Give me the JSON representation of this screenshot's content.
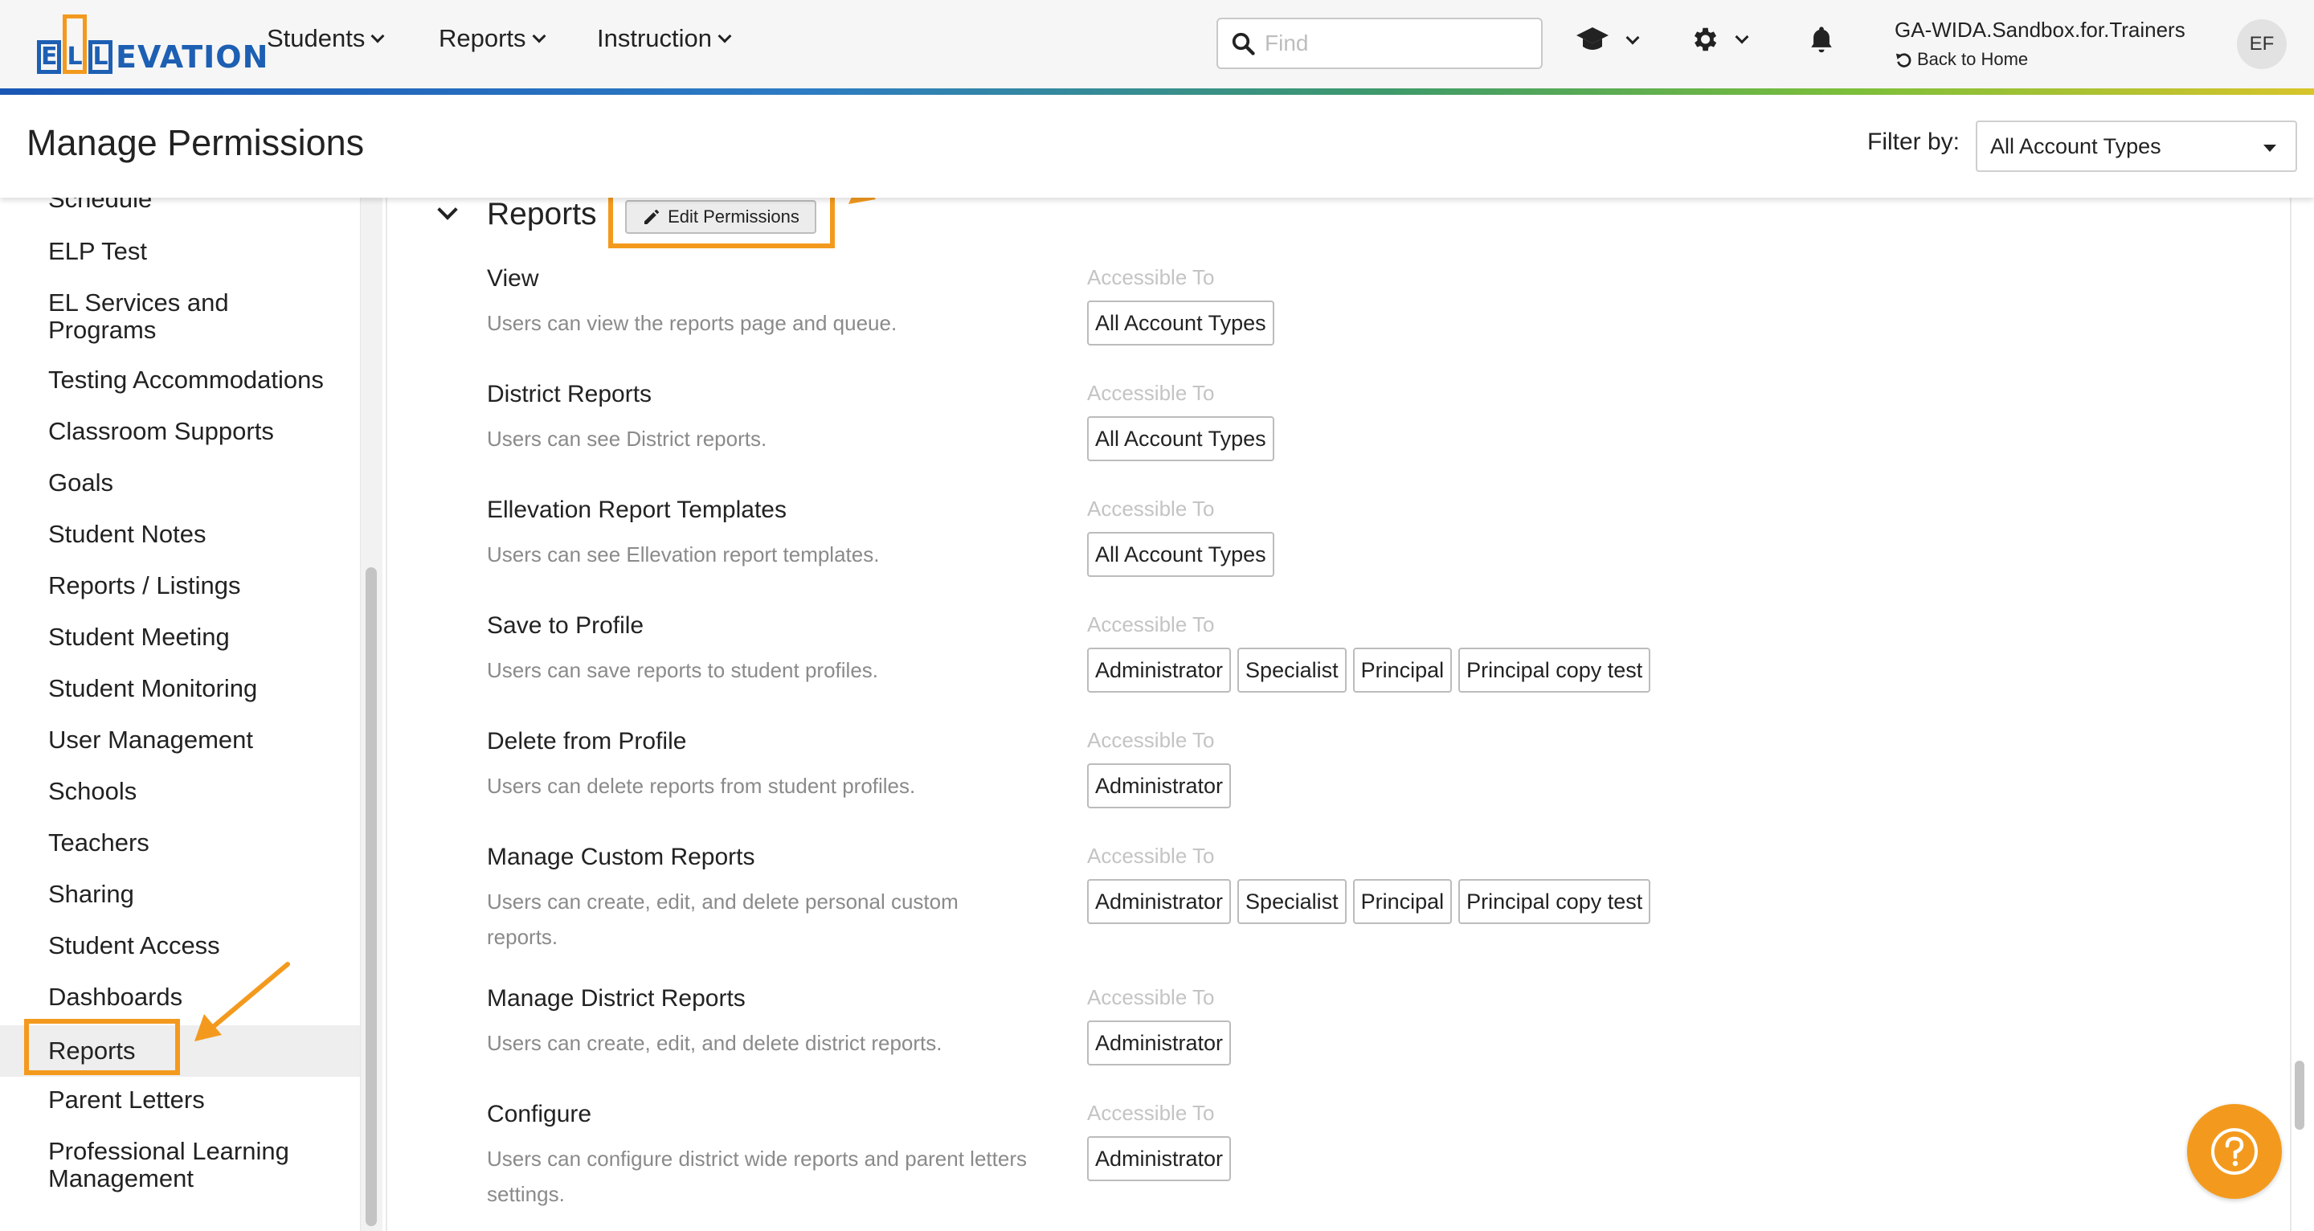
{
  "logo": {
    "letters": [
      "E",
      "L",
      "L"
    ],
    "rest": "EVATION"
  },
  "nav": {
    "items": [
      "Students",
      "Reports",
      "Instruction"
    ]
  },
  "search": {
    "placeholder": "Find"
  },
  "user": {
    "name": "GA-WIDA.Sandbox.for.Trainers",
    "back": "Back to Home",
    "initials": "EF"
  },
  "page": {
    "title": "Manage Permissions",
    "filter_label": "Filter by:",
    "filter_value": "All Account Types"
  },
  "sidebar": {
    "items": [
      "Schedule",
      "ELP Test",
      "EL Services and Programs",
      "Testing Accommodations",
      "Classroom Supports",
      "Goals",
      "Student Notes",
      "Reports / Listings",
      "Student Meeting",
      "Student Monitoring",
      "User Management",
      "Schools",
      "Teachers",
      "Sharing",
      "Student Access",
      "Dashboards",
      "Reports",
      "Parent Letters",
      "Professional Learning Management"
    ],
    "active": "Reports"
  },
  "section": {
    "title": "Reports",
    "edit_label": "Edit Permissions"
  },
  "accessible_label": "Accessible To",
  "permissions": [
    {
      "title": "View",
      "desc": "Users can view the reports page and queue.",
      "roles": [
        "All Account Types"
      ]
    },
    {
      "title": "District Reports",
      "desc": "Users can see District reports.",
      "roles": [
        "All Account Types"
      ]
    },
    {
      "title": "Ellevation Report Templates",
      "desc": "Users can see Ellevation report templates.",
      "roles": [
        "All Account Types"
      ]
    },
    {
      "title": "Save to Profile",
      "desc": "Users can save reports to student profiles.",
      "roles": [
        "Administrator",
        "Specialist",
        "Principal",
        "Principal copy test"
      ]
    },
    {
      "title": "Delete from Profile",
      "desc": "Users can delete reports from student profiles.",
      "roles": [
        "Administrator"
      ]
    },
    {
      "title": "Manage Custom Reports",
      "desc": "Users can create, edit, and delete personal custom reports.",
      "roles": [
        "Administrator",
        "Specialist",
        "Principal",
        "Principal copy test"
      ]
    },
    {
      "title": "Manage District Reports",
      "desc": "Users can create, edit, and delete district reports.",
      "roles": [
        "Administrator"
      ]
    },
    {
      "title": "Configure",
      "desc": "Users can configure district wide reports and parent letters settings.",
      "roles": [
        "Administrator"
      ]
    }
  ],
  "colors": {
    "accent": "#f39a1e",
    "brand": "#1d5fb3"
  },
  "icons": [
    "search-icon",
    "graduation-cap-icon",
    "gear-icon",
    "bell-icon",
    "undo-icon",
    "pencil-icon",
    "help-icon"
  ]
}
